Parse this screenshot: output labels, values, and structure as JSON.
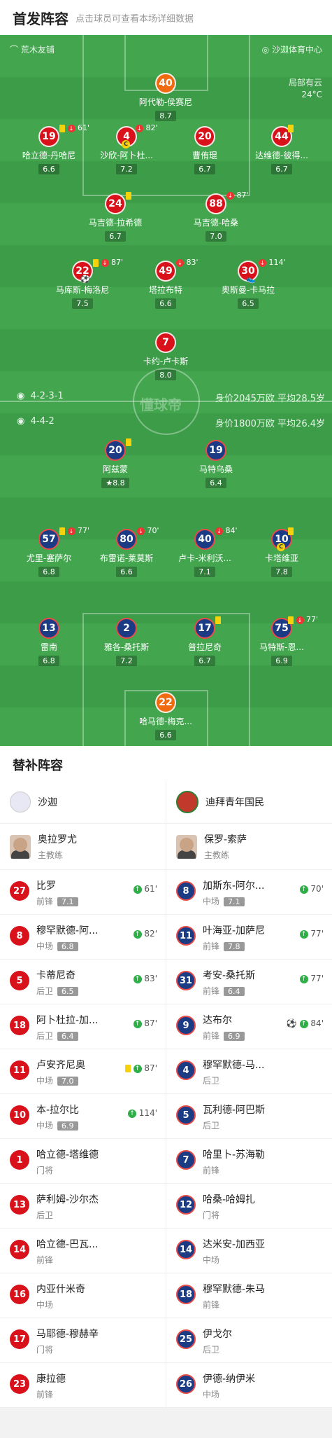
{
  "header": {
    "title": "首发阵容",
    "subtitle": "点击球员可查看本场详细数据"
  },
  "pitch_top": {
    "home_venue": "荒木友铺",
    "away_venue": "沙迦体育中心",
    "weather": "局部有云",
    "temperature": "24°C"
  },
  "team1": {
    "formation": "4-2-3-1",
    "info": "身价2045万欧 平均28.5岁"
  },
  "team2": {
    "formation": "4-4-2",
    "info": "身价1800万欧 平均26.4岁"
  },
  "watermark": "懂球帝",
  "team1_players": [
    {
      "num": "40",
      "name": "阿代勒-侯赛尼",
      "rating": "8.7"
    },
    {
      "num": "19",
      "name": "哈立德-丹哈尼",
      "rating": "6.6",
      "event": "61'"
    },
    {
      "num": "4",
      "name": "沙欣-阿卜杜...",
      "rating": "7.2",
      "event": "82'"
    },
    {
      "num": "20",
      "name": "曹侑琨",
      "rating": "6.7"
    },
    {
      "num": "44",
      "name": "达维德-彼得...",
      "rating": "6.7"
    },
    {
      "num": "24",
      "name": "马吉德-拉希德",
      "rating": "6.7"
    },
    {
      "num": "88",
      "name": "马吉德-哈桑",
      "rating": "7.0",
      "event": "87'"
    },
    {
      "num": "22",
      "name": "马库斯-梅洛尼",
      "rating": "7.5",
      "event": "87'"
    },
    {
      "num": "49",
      "name": "塔拉布特",
      "rating": "6.6",
      "event": "83'"
    },
    {
      "num": "30",
      "name": "奥斯曼-卡马拉",
      "rating": "6.5",
      "event": "114'"
    },
    {
      "num": "7",
      "name": "卡约-卢卡斯",
      "rating": "8.0"
    }
  ],
  "team2_players": [
    {
      "num": "20",
      "name": "阿兹蒙",
      "rating": "8.8"
    },
    {
      "num": "19",
      "name": "马特乌桑",
      "rating": "6.4"
    },
    {
      "num": "57",
      "name": "尤里-塞萨尔",
      "rating": "6.8",
      "event": "77'"
    },
    {
      "num": "80",
      "name": "布雷诺-莱莫斯",
      "rating": "6.6",
      "event": "70'"
    },
    {
      "num": "40",
      "name": "卢卡-米利沃...",
      "rating": "7.1",
      "event": "84'"
    },
    {
      "num": "10",
      "name": "卡塔维亚",
      "rating": "7.8"
    },
    {
      "num": "13",
      "name": "雷南",
      "rating": "6.8"
    },
    {
      "num": "2",
      "name": "雅各-桑托斯",
      "rating": "7.2"
    },
    {
      "num": "17",
      "name": "普拉尼奇",
      "rating": "6.7"
    },
    {
      "num": "75",
      "name": "马特斯-恩...",
      "rating": "6.9",
      "event": "77'"
    },
    {
      "num": "22",
      "name": "哈马德-梅克...",
      "rating": "6.6"
    }
  ],
  "subs": {
    "title": "替补阵容",
    "left": {
      "team": "沙迦",
      "coach": {
        "name": "奥拉罗尤",
        "role": "主教练"
      },
      "players": [
        {
          "num": "27",
          "name": "比罗",
          "pos": "前锋",
          "rating": "7.1",
          "event": "61'"
        },
        {
          "num": "8",
          "name": "穆罕默德-阿...",
          "pos": "中场",
          "rating": "6.8",
          "event": "82'"
        },
        {
          "num": "5",
          "name": "卡蒂尼奇",
          "pos": "后卫",
          "rating": "6.5",
          "event": "83'"
        },
        {
          "num": "18",
          "name": "阿卜杜拉-加...",
          "pos": "后卫",
          "rating": "6.4",
          "event": "87'"
        },
        {
          "num": "11",
          "name": "卢安齐尼奥",
          "pos": "中场",
          "rating": "7.0",
          "event": "87'"
        },
        {
          "num": "10",
          "name": "本-拉尔比",
          "pos": "中场",
          "rating": "6.9",
          "event": "114'"
        },
        {
          "num": "1",
          "name": "哈立德-塔维德",
          "pos": "门将",
          "rating": "",
          "event": ""
        },
        {
          "num": "13",
          "name": "萨利姆-沙尔杰",
          "pos": "后卫",
          "rating": "",
          "event": ""
        },
        {
          "num": "14",
          "name": "哈立德-巴瓦...",
          "pos": "前锋",
          "rating": "",
          "event": ""
        },
        {
          "num": "16",
          "name": "内亚什米奇",
          "pos": "中场",
          "rating": "",
          "event": ""
        },
        {
          "num": "17",
          "name": "马耶德-穆赫辛",
          "pos": "门将",
          "rating": "",
          "event": ""
        },
        {
          "num": "23",
          "name": "康拉德",
          "pos": "前锋",
          "rating": "",
          "event": ""
        }
      ]
    },
    "right": {
      "team": "迪拜青年国民",
      "coach": {
        "name": "保罗-索萨",
        "role": "主教练"
      },
      "players": [
        {
          "num": "8",
          "name": "加斯东-阿尔...",
          "pos": "中场",
          "rating": "7.1",
          "event": "70'"
        },
        {
          "num": "11",
          "name": "叶海亚-加萨尼",
          "pos": "前锋",
          "rating": "7.8",
          "event": "77'"
        },
        {
          "num": "31",
          "name": "考安-桑托斯",
          "pos": "前锋",
          "rating": "6.4",
          "event": "77'"
        },
        {
          "num": "9",
          "name": "达布尔",
          "pos": "前锋",
          "rating": "6.9",
          "event": "84'"
        },
        {
          "num": "4",
          "name": "穆罕默德-马...",
          "pos": "后卫",
          "rating": "",
          "event": ""
        },
        {
          "num": "5",
          "name": "瓦利德-阿巴斯",
          "pos": "后卫",
          "rating": "",
          "event": ""
        },
        {
          "num": "7",
          "name": "哈里卜-苏海勒",
          "pos": "前锋",
          "rating": "",
          "event": ""
        },
        {
          "num": "12",
          "name": "哈桑-哈姆扎",
          "pos": "门将",
          "rating": "",
          "event": ""
        },
        {
          "num": "14",
          "name": "达米安-加西亚",
          "pos": "中场",
          "rating": "",
          "event": ""
        },
        {
          "num": "18",
          "name": "穆罕默德-朱马",
          "pos": "前锋",
          "rating": "",
          "event": ""
        },
        {
          "num": "25",
          "name": "伊戈尔",
          "pos": "后卫",
          "rating": "",
          "event": ""
        },
        {
          "num": "26",
          "name": "伊德-纳伊米",
          "pos": "中场",
          "rating": "",
          "event": ""
        }
      ]
    }
  }
}
